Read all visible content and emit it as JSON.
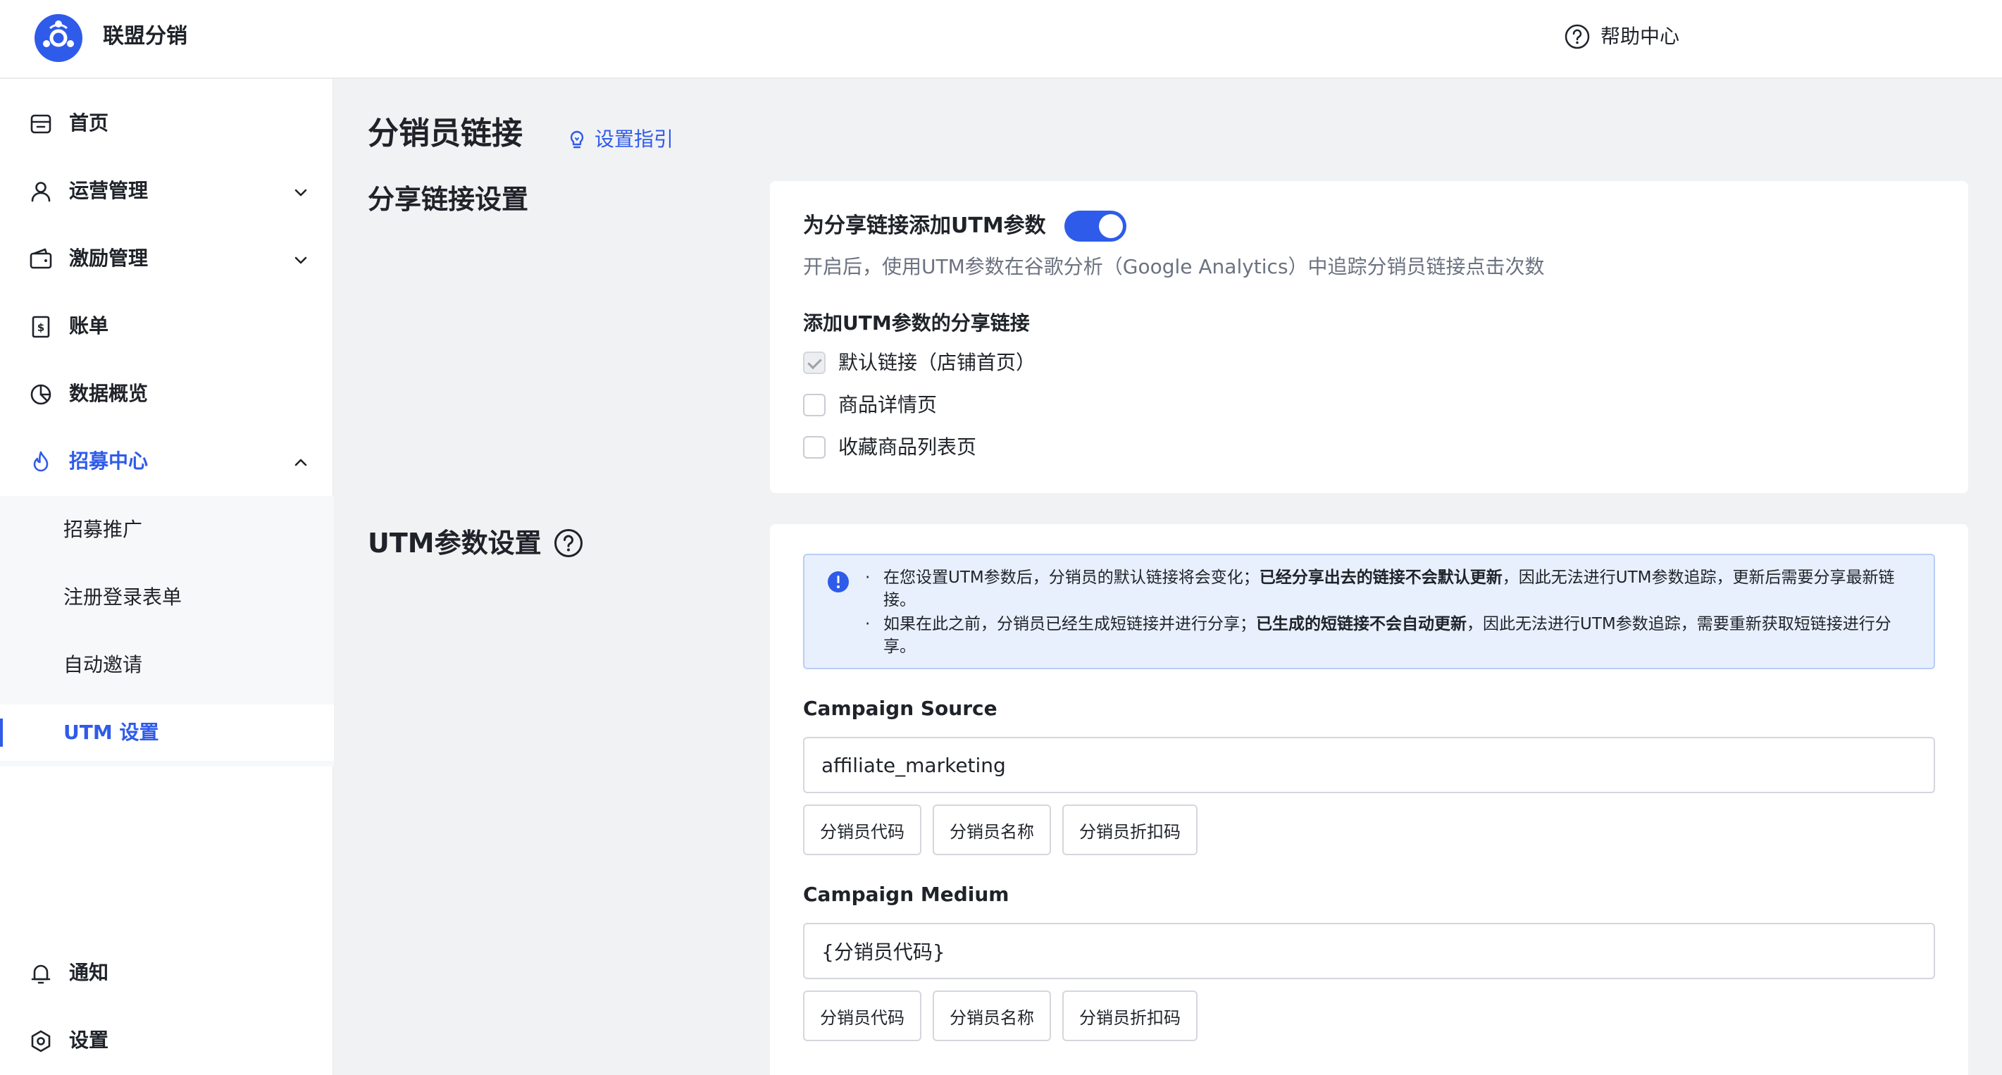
{
  "app": {
    "title": "联盟分销"
  },
  "header": {
    "help_label": "帮助中心"
  },
  "sidebar": {
    "items": [
      {
        "label": "首页",
        "icon": "home-icon"
      },
      {
        "label": "运营管理",
        "icon": "user-icon",
        "expandable": true
      },
      {
        "label": "激励管理",
        "icon": "wallet-icon",
        "expandable": true
      },
      {
        "label": "账单",
        "icon": "bill-icon"
      },
      {
        "label": "数据概览",
        "icon": "pie-chart-icon"
      },
      {
        "label": "招募中心",
        "icon": "flame-icon",
        "expanded": true,
        "active": true
      }
    ],
    "sub_items": [
      {
        "label": "招募推广"
      },
      {
        "label": "注册登录表单"
      },
      {
        "label": "自动邀请"
      },
      {
        "label": "UTM 设置",
        "selected": true
      }
    ],
    "bottom_items": [
      {
        "label": "通知",
        "icon": "bell-icon"
      },
      {
        "label": "设置",
        "icon": "gear-icon"
      }
    ]
  },
  "main": {
    "page_title": "分销员链接",
    "guide_label": "设置指引",
    "share_section": {
      "title": "分享链接设置",
      "toggle_label": "为分享链接添加UTM参数",
      "toggle_on": true,
      "toggle_desc": "开启后，使用UTM参数在谷歌分析（Google Analytics）中追踪分销员链接点击次数",
      "links_title": "添加UTM参数的分享链接",
      "links": [
        {
          "label": "默认链接（店铺首页）",
          "checked": true,
          "disabled": true
        },
        {
          "label": "商品详情页",
          "checked": false
        },
        {
          "label": "收藏商品列表页",
          "checked": false
        }
      ]
    },
    "utm_section": {
      "title": "UTM参数设置",
      "info": {
        "line1_a": "在您设置UTM参数后，分销员的默认链接将会变化；",
        "line1_b": "已经分享出去的链接不会默认更新",
        "line1_c": "，因此无法进行UTM参数追踪，更新后需要分享最新链接。",
        "line2_a": "如果在此之前，分销员已经生成短链接并进行分享；",
        "line2_b": "已生成的短链接不会自动更新",
        "line2_c": "，因此无法进行UTM参数追踪，需要重新获取短链接进行分享。"
      },
      "fields": [
        {
          "label": "Campaign Source",
          "value": "affiliate_marketing",
          "chips": [
            "分销员代码",
            "分销员名称",
            "分销员折扣码"
          ]
        },
        {
          "label": "Campaign Medium",
          "value": "{分销员代码}",
          "chips": [
            "分销员代码",
            "分销员名称",
            "分销员折扣码"
          ]
        }
      ]
    }
  },
  "colors": {
    "accent": "#2f5bea",
    "info_bg": "#e8f0fd"
  }
}
